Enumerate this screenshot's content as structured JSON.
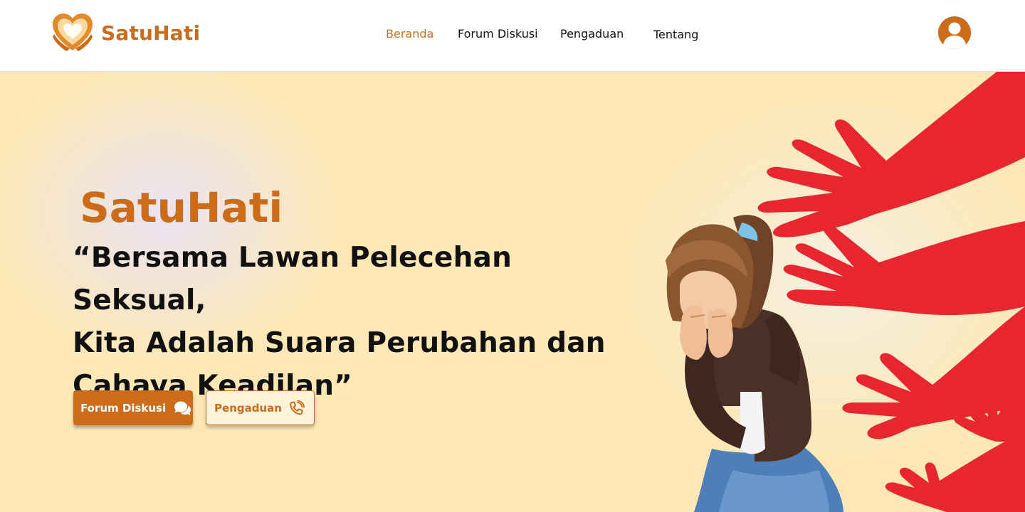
{
  "header": {
    "brand_name": "SatuHati",
    "nav": {
      "home": "Beranda",
      "forum": "Forum Diskusi",
      "complaint": "Pengaduan",
      "about": "Tentang"
    },
    "active_nav": "Beranda",
    "icons": {
      "logo": "heart-hands-logo-icon",
      "profile": "user-circle-icon"
    }
  },
  "hero": {
    "title": "SatuHati",
    "quote_line1": "“Bersama Lawan Pelecehan Seksual,",
    "quote_line2": "Kita Adalah Suara Perubahan dan",
    "quote_line3": "Cahaya Keadilan”",
    "primary_button": {
      "label": "Forum Diskusi",
      "icon": "chat-bubbles-icon"
    },
    "secondary_button": {
      "label": "Pengaduan",
      "icon": "phone-call-icon"
    },
    "illustration": "crying-woman-with-red-hands-illustration"
  },
  "colors": {
    "accent": "#cc6b1a",
    "hero_background": "#fde8b5",
    "hands": "#e8262f",
    "text": "#111111",
    "white": "#ffffff"
  }
}
